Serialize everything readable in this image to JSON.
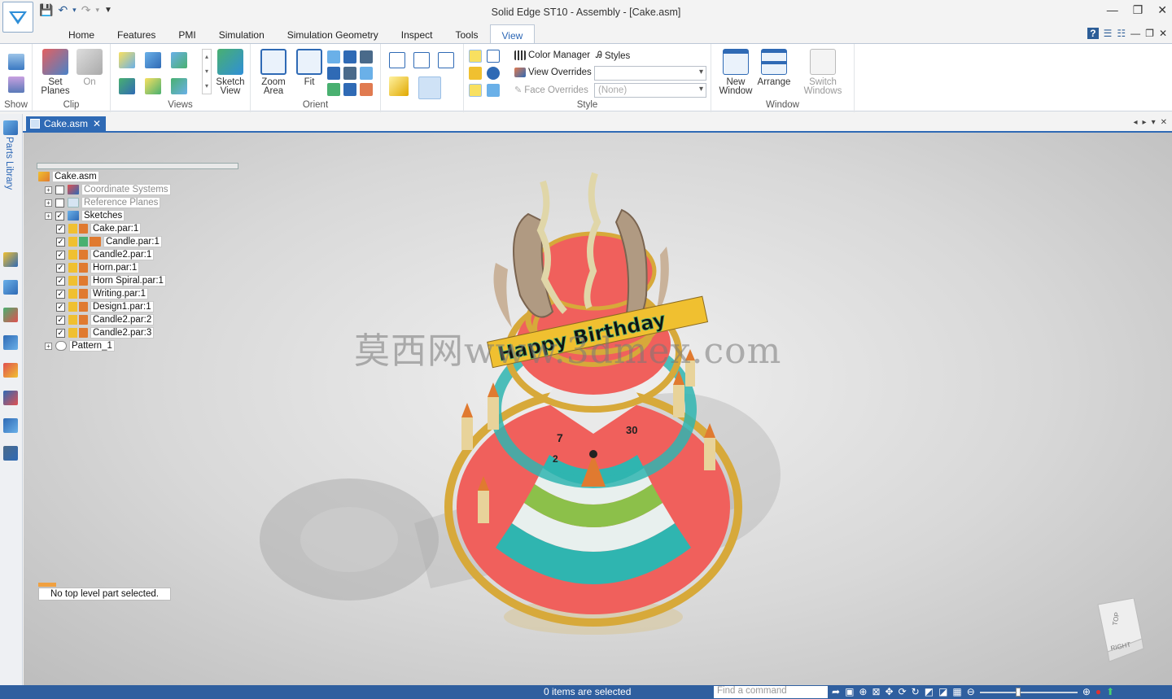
{
  "window": {
    "title": "Solid Edge ST10 - Assembly - [Cake.asm]"
  },
  "tabs": [
    "Home",
    "Features",
    "PMI",
    "Simulation",
    "Simulation Geometry",
    "Inspect",
    "Tools",
    "View"
  ],
  "ribbon": {
    "show_label": "Show",
    "clip": {
      "set_planes": "Set Planes",
      "on": "On",
      "label": "Clip"
    },
    "views": {
      "sketch_view": "Sketch View",
      "label": "Views"
    },
    "orient": {
      "zoom_area": "Zoom Area",
      "fit": "Fit",
      "label": "Orient"
    },
    "style": {
      "color_manager": "Color Manager",
      "styles": "Styles",
      "view_overrides": "View Overrides",
      "view_overrides_value": "",
      "face_overrides": "Face Overrides",
      "face_overrides_value": "(None)",
      "label": "Style"
    },
    "window": {
      "new_window": "New Window",
      "arrange": "Arrange",
      "switch_windows": "Switch Windows",
      "label": "Window"
    }
  },
  "rail": {
    "parts_library": "Parts Library"
  },
  "document_tab": "Cake.asm",
  "tree": {
    "root": "Cake.asm",
    "items": [
      {
        "label": "Coordinate Systems",
        "dim": true,
        "checked": false
      },
      {
        "label": "Reference Planes",
        "dim": true,
        "checked": false
      },
      {
        "label": "Sketches",
        "checked": true
      },
      {
        "label": "Cake.par:1",
        "checked": true
      },
      {
        "label": "Candle.par:1",
        "checked": true
      },
      {
        "label": "Candle2.par:1",
        "checked": true
      },
      {
        "label": "Horn.par:1",
        "checked": true
      },
      {
        "label": "Horn Spiral.par:1",
        "checked": true
      },
      {
        "label": "Writing.par:1",
        "checked": true
      },
      {
        "label": "Design1.par:1",
        "checked": true
      },
      {
        "label": "Candle2.par:2",
        "checked": true
      },
      {
        "label": "Candle2.par:3",
        "checked": true
      },
      {
        "label": "Pattern_1"
      }
    ]
  },
  "message": "No top level part selected.",
  "model": {
    "banner": "Happy Birthday",
    "numbers": [
      "7",
      "30",
      "2"
    ]
  },
  "watermark": "莫西网www.3dmex.com",
  "view_cube": {
    "top": "TOP",
    "right": "RIGHT"
  },
  "status": {
    "selection": "0 items are selected",
    "find_placeholder": "Find a command"
  },
  "colors": {
    "accent": "#2f6ab5",
    "cake_red": "#f0605c",
    "gold": "#d7a93a",
    "teal": "#2fb5b0"
  }
}
